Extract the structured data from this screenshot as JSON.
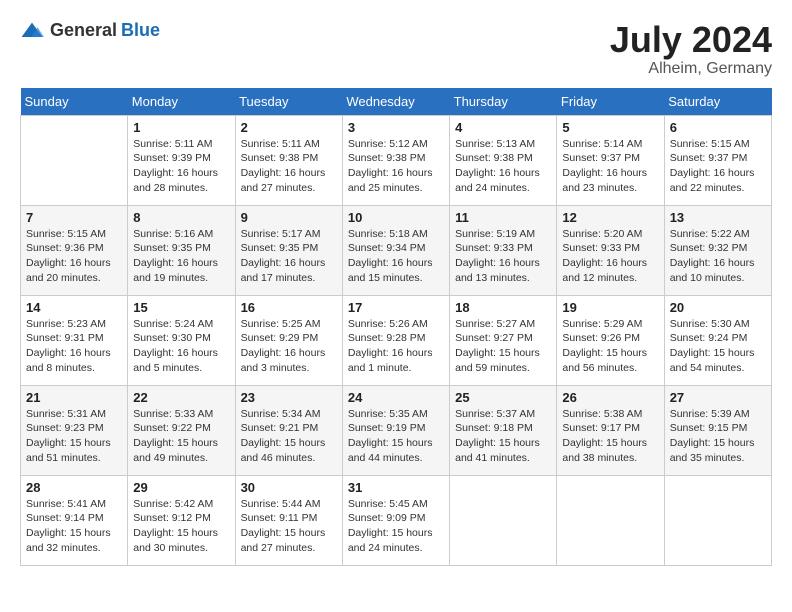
{
  "header": {
    "logo_general": "General",
    "logo_blue": "Blue",
    "month_title": "July 2024",
    "location": "Alheim, Germany"
  },
  "days_of_week": [
    "Sunday",
    "Monday",
    "Tuesday",
    "Wednesday",
    "Thursday",
    "Friday",
    "Saturday"
  ],
  "weeks": [
    [
      {
        "day": "",
        "info": ""
      },
      {
        "day": "1",
        "info": "Sunrise: 5:11 AM\nSunset: 9:39 PM\nDaylight: 16 hours\nand 28 minutes."
      },
      {
        "day": "2",
        "info": "Sunrise: 5:11 AM\nSunset: 9:38 PM\nDaylight: 16 hours\nand 27 minutes."
      },
      {
        "day": "3",
        "info": "Sunrise: 5:12 AM\nSunset: 9:38 PM\nDaylight: 16 hours\nand 25 minutes."
      },
      {
        "day": "4",
        "info": "Sunrise: 5:13 AM\nSunset: 9:38 PM\nDaylight: 16 hours\nand 24 minutes."
      },
      {
        "day": "5",
        "info": "Sunrise: 5:14 AM\nSunset: 9:37 PM\nDaylight: 16 hours\nand 23 minutes."
      },
      {
        "day": "6",
        "info": "Sunrise: 5:15 AM\nSunset: 9:37 PM\nDaylight: 16 hours\nand 22 minutes."
      }
    ],
    [
      {
        "day": "7",
        "info": "Sunrise: 5:15 AM\nSunset: 9:36 PM\nDaylight: 16 hours\nand 20 minutes."
      },
      {
        "day": "8",
        "info": "Sunrise: 5:16 AM\nSunset: 9:35 PM\nDaylight: 16 hours\nand 19 minutes."
      },
      {
        "day": "9",
        "info": "Sunrise: 5:17 AM\nSunset: 9:35 PM\nDaylight: 16 hours\nand 17 minutes."
      },
      {
        "day": "10",
        "info": "Sunrise: 5:18 AM\nSunset: 9:34 PM\nDaylight: 16 hours\nand 15 minutes."
      },
      {
        "day": "11",
        "info": "Sunrise: 5:19 AM\nSunset: 9:33 PM\nDaylight: 16 hours\nand 13 minutes."
      },
      {
        "day": "12",
        "info": "Sunrise: 5:20 AM\nSunset: 9:33 PM\nDaylight: 16 hours\nand 12 minutes."
      },
      {
        "day": "13",
        "info": "Sunrise: 5:22 AM\nSunset: 9:32 PM\nDaylight: 16 hours\nand 10 minutes."
      }
    ],
    [
      {
        "day": "14",
        "info": "Sunrise: 5:23 AM\nSunset: 9:31 PM\nDaylight: 16 hours\nand 8 minutes."
      },
      {
        "day": "15",
        "info": "Sunrise: 5:24 AM\nSunset: 9:30 PM\nDaylight: 16 hours\nand 5 minutes."
      },
      {
        "day": "16",
        "info": "Sunrise: 5:25 AM\nSunset: 9:29 PM\nDaylight: 16 hours\nand 3 minutes."
      },
      {
        "day": "17",
        "info": "Sunrise: 5:26 AM\nSunset: 9:28 PM\nDaylight: 16 hours\nand 1 minute."
      },
      {
        "day": "18",
        "info": "Sunrise: 5:27 AM\nSunset: 9:27 PM\nDaylight: 15 hours\nand 59 minutes."
      },
      {
        "day": "19",
        "info": "Sunrise: 5:29 AM\nSunset: 9:26 PM\nDaylight: 15 hours\nand 56 minutes."
      },
      {
        "day": "20",
        "info": "Sunrise: 5:30 AM\nSunset: 9:24 PM\nDaylight: 15 hours\nand 54 minutes."
      }
    ],
    [
      {
        "day": "21",
        "info": "Sunrise: 5:31 AM\nSunset: 9:23 PM\nDaylight: 15 hours\nand 51 minutes."
      },
      {
        "day": "22",
        "info": "Sunrise: 5:33 AM\nSunset: 9:22 PM\nDaylight: 15 hours\nand 49 minutes."
      },
      {
        "day": "23",
        "info": "Sunrise: 5:34 AM\nSunset: 9:21 PM\nDaylight: 15 hours\nand 46 minutes."
      },
      {
        "day": "24",
        "info": "Sunrise: 5:35 AM\nSunset: 9:19 PM\nDaylight: 15 hours\nand 44 minutes."
      },
      {
        "day": "25",
        "info": "Sunrise: 5:37 AM\nSunset: 9:18 PM\nDaylight: 15 hours\nand 41 minutes."
      },
      {
        "day": "26",
        "info": "Sunrise: 5:38 AM\nSunset: 9:17 PM\nDaylight: 15 hours\nand 38 minutes."
      },
      {
        "day": "27",
        "info": "Sunrise: 5:39 AM\nSunset: 9:15 PM\nDaylight: 15 hours\nand 35 minutes."
      }
    ],
    [
      {
        "day": "28",
        "info": "Sunrise: 5:41 AM\nSunset: 9:14 PM\nDaylight: 15 hours\nand 32 minutes."
      },
      {
        "day": "29",
        "info": "Sunrise: 5:42 AM\nSunset: 9:12 PM\nDaylight: 15 hours\nand 30 minutes."
      },
      {
        "day": "30",
        "info": "Sunrise: 5:44 AM\nSunset: 9:11 PM\nDaylight: 15 hours\nand 27 minutes."
      },
      {
        "day": "31",
        "info": "Sunrise: 5:45 AM\nSunset: 9:09 PM\nDaylight: 15 hours\nand 24 minutes."
      },
      {
        "day": "",
        "info": ""
      },
      {
        "day": "",
        "info": ""
      },
      {
        "day": "",
        "info": ""
      }
    ]
  ]
}
